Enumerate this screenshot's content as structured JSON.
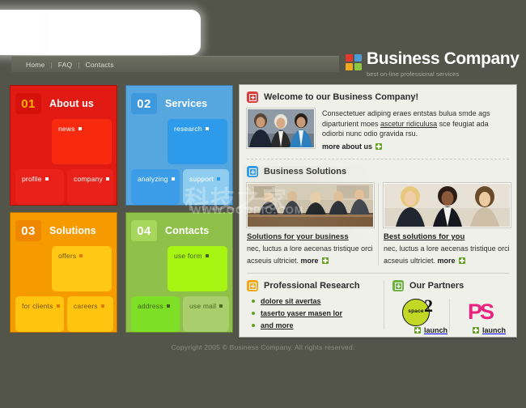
{
  "colors": {
    "page_bg": "#53544a",
    "content_bg": "#f0f0eb",
    "red": "#e11b13",
    "blue": "#56a7e0",
    "orange": "#f59b00",
    "green": "#8fc04a",
    "accent_green": "#63a321",
    "partner_ps": "#e8247f",
    "partner_space2": "#c3d824"
  },
  "header": {
    "nav": [
      {
        "label": "Home"
      },
      {
        "label": "FAQ"
      },
      {
        "label": "Contacts"
      }
    ],
    "nav_separator": "|",
    "brand_title": "Business Company",
    "brand_tagline": "best on-line professional services",
    "logo_squares": [
      "#e03a2f",
      "#4e9bd6",
      "#f0a81e",
      "#8ec63f"
    ]
  },
  "tiles": [
    {
      "number": "01",
      "title": "About us",
      "bg": "#e11b13",
      "num_bg": "#d4110a",
      "num_color": "#ffb400",
      "sub_big": {
        "label": "news",
        "bg": "#f72a10",
        "color": "#ffffff",
        "bullet": "#ffffff"
      },
      "sub_left": {
        "label": "profile",
        "bg": "#e8221a",
        "color": "#ffffff",
        "bullet": "#ffffff"
      },
      "sub_right": {
        "label": "company",
        "bg": "#e8221a",
        "color": "#ffffff",
        "bullet": "#ffffff"
      }
    },
    {
      "number": "02",
      "title": "Services",
      "bg": "#56a7e0",
      "num_bg": "#3d98dd",
      "num_color": "#ffffff",
      "sub_big": {
        "label": "research",
        "bg": "#2e9bea",
        "color": "#ffffff",
        "bullet": "#ffffff"
      },
      "sub_left": {
        "label": "analyzing",
        "bg": "#3b9ce8",
        "color": "#ffffff",
        "bullet": "#ffffff"
      },
      "sub_right": {
        "label": "support",
        "bg": "#8ecdf0",
        "color": "#ffffff",
        "bullet": "#2e9bea"
      }
    },
    {
      "number": "03",
      "title": "Solutions",
      "bg": "#f59b00",
      "num_bg": "#ef8700",
      "num_color": "#ffffff",
      "sub_big": {
        "label": "offers",
        "bg": "#ffc814",
        "color": "#7a5300",
        "bullet": "#e07b00"
      },
      "sub_left": {
        "label": "for clients",
        "bg": "#ffc40f",
        "color": "#7a5300",
        "bullet": "#e07b00"
      },
      "sub_right": {
        "label": "careers",
        "bg": "#ffc40f",
        "color": "#7a5300",
        "bullet": "#e07b00"
      }
    },
    {
      "number": "04",
      "title": "Contacts",
      "bg": "#8fc04a",
      "num_bg": "#a7d65c",
      "num_color": "#ffffff",
      "sub_big": {
        "label": "use form",
        "bg": "#a6f412",
        "color": "#46611a",
        "bullet": "#46611a"
      },
      "sub_left": {
        "label": "address",
        "bg": "#7ee026",
        "color": "#3f5e18",
        "bullet": "#3f5e18"
      },
      "sub_right": {
        "label": "use mail",
        "bg": "#a8cf6b",
        "color": "#4a6724",
        "bullet": "#4a6724"
      }
    }
  ],
  "content": {
    "welcome": {
      "icon_color": "#d93d3d",
      "title": "Welcome to our Business Company!",
      "text_before": "Consectetuer adiping eraes entstas bulua smde ags diparturient moes ",
      "text_link": "ascetur ridiculusa",
      "text_after": " sce feugiat ada odiorbi nunc odio gravida rsu.",
      "more_label": "more about us",
      "photo_alt": "three-people-photo"
    },
    "solutions": {
      "icon_color": "#2e9bea",
      "title": "Business Solutions",
      "items": [
        {
          "heading": "Solutions for your business",
          "text": "nec, luctus a lore aecenas tristique orci acseuis ultriciet.",
          "more_label": "more",
          "photo_alt": "boardroom-meeting-photo"
        },
        {
          "heading": "Best solutions for you",
          "text": "nec, luctus a lore aecenas tristique orci acseuis ultriciet.",
          "more_label": "more",
          "photo_alt": "three-businesswomen-photo"
        }
      ]
    },
    "research": {
      "icon_color": "#f0a81e",
      "title": "Professional Research",
      "links": [
        "dolore sit avertas",
        "taserto yaser masen lor",
        "and more"
      ]
    },
    "partners": {
      "icon_color": "#6cb33f",
      "title": "Our Partners",
      "items": [
        {
          "name": "space2",
          "logo_text": "space",
          "logo_suffix": "2",
          "launch_label": "launch"
        },
        {
          "name": "PS",
          "logo_text": "PS",
          "launch_label": "launch"
        }
      ]
    }
  },
  "footer": {
    "copyright": "Copyright 2005 © Business Company. All rights reserved."
  },
  "watermark": {
    "line1": "科技之家",
    "line2": "WWW.OOOPIC.COM"
  }
}
